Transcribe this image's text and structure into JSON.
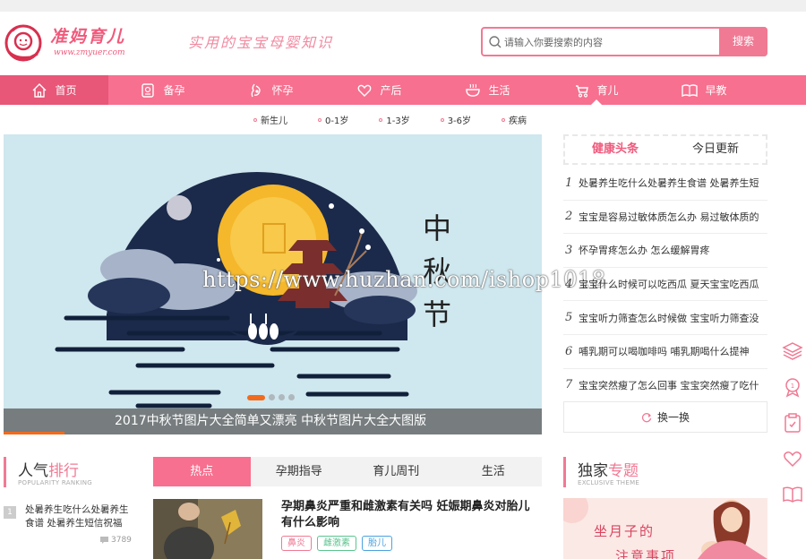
{
  "header": {
    "logo_title": "准妈育儿",
    "logo_url": "www.zmyuer.com",
    "slogan": "实用的宝宝母婴知识",
    "search_placeholder": "请输入你要搜索的内容",
    "search_button": "搜索"
  },
  "nav": {
    "items": [
      {
        "label": "首页",
        "icon": "home-icon"
      },
      {
        "label": "备孕",
        "icon": "pregnancy-prep-icon"
      },
      {
        "label": "怀孕",
        "icon": "pregnant-icon"
      },
      {
        "label": "产后",
        "icon": "postpartum-icon"
      },
      {
        "label": "生活",
        "icon": "bowl-icon"
      },
      {
        "label": "育儿",
        "icon": "stroller-icon"
      },
      {
        "label": "早教",
        "icon": "book-icon"
      }
    ],
    "active_index": 0,
    "current_index": 5
  },
  "subnav": [
    "新生儿",
    "0-1岁",
    "1-3岁",
    "3-6岁",
    "疾病"
  ],
  "banner": {
    "caption": "2017中秋节图片大全简单又漂亮 中秋节图片大全大图版",
    "art_text": [
      "中",
      "秋",
      "节"
    ],
    "slide_count": 4,
    "active_slide": 0
  },
  "health": {
    "tabs": [
      "健康头条",
      "今日更新"
    ],
    "items": [
      {
        "num": "1",
        "text": "处暑养生吃什么处暑养生食谱 处暑养生短"
      },
      {
        "num": "2",
        "text": "宝宝是容易过敏体质怎么办 易过敏体质的"
      },
      {
        "num": "3",
        "text": "怀孕胃疼怎么办 怎么缓解胃疼"
      },
      {
        "num": "4",
        "text": "宝宝什么时候可以吃西瓜 夏天宝宝吃西瓜"
      },
      {
        "num": "5",
        "text": "宝宝听力筛查怎么时候做 宝宝听力筛查没"
      },
      {
        "num": "6",
        "text": "哺乳期可以喝咖啡吗 哺乳期喝什么提神"
      },
      {
        "num": "7",
        "text": "宝宝突然瘦了怎么回事 宝宝突然瘦了吃什"
      }
    ],
    "refresh": "换一换"
  },
  "side_icons": [
    "layers-icon",
    "medal-icon",
    "clipboard-icon",
    "heart-hands-icon",
    "open-book-icon"
  ],
  "ranking": {
    "title_a": "人气",
    "title_b": "排行",
    "subtitle": "POPULARITY RANKING",
    "items": [
      {
        "num": "1",
        "text": "处暑养生吃什么处暑养生食谱 处暑养生短信祝福",
        "count": "3789"
      }
    ]
  },
  "hot": {
    "tabs": [
      "热点",
      "孕期指导",
      "育儿周刊",
      "生活"
    ],
    "article_title": "孕期鼻炎严重和雌激素有关吗 妊娠期鼻炎对胎儿有什么影响",
    "tags": [
      {
        "label": "鼻炎",
        "color": "#f07a94"
      },
      {
        "label": "雌激素",
        "color": "#5bc48f"
      },
      {
        "label": "胎儿",
        "color": "#4aa3df"
      }
    ]
  },
  "exclusive": {
    "title_a": "独家",
    "title_b": "专题",
    "subtitle": "EXCLUSIVE THEME",
    "img_text1": "坐月子的",
    "img_text2": "注意事项"
  },
  "watermark": "https://www.huzhan.com/ishop1018",
  "colors": {
    "brand": "#f7708f",
    "brand_dark": "#e85678",
    "accent_orange": "#f26b1d"
  }
}
